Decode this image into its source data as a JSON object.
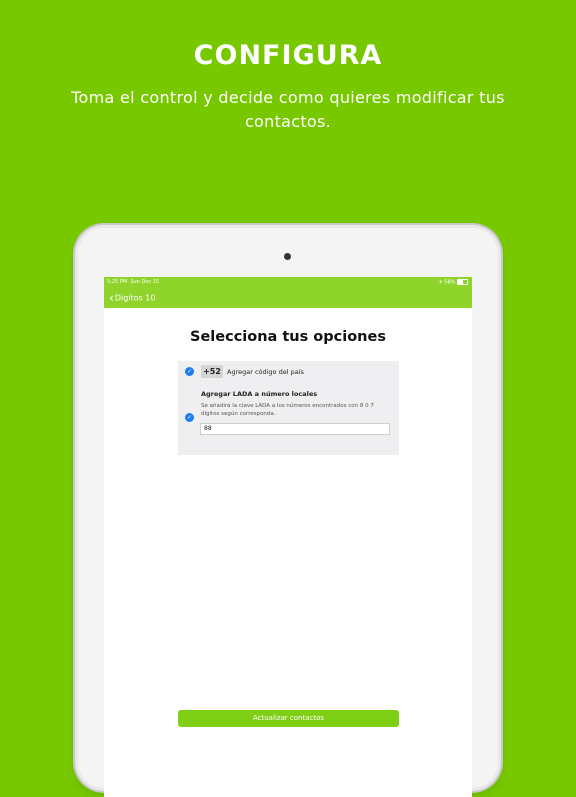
{
  "hero": {
    "title": "CONFIGURA",
    "subtitle": "Toma el control y decide como quieres modificar tus contactos."
  },
  "status_bar": {
    "time": "5:25 PM",
    "date": "Sun Dec 15",
    "battery": "58%"
  },
  "nav": {
    "back_label": "Digitos 10"
  },
  "page": {
    "title": "Selecciona tus opciones"
  },
  "options": {
    "country_code": "+52",
    "country_label": "Agregar código del país",
    "lada_title": "Agregar LADA a número locales",
    "lada_description": "Se añadirá la clave LADA a los números encontrados con 8 0 7 dígitos según corresponda.",
    "lada_value": "88"
  },
  "actions": {
    "update_label": "Actualizar contactos"
  },
  "colors": {
    "background": "#78c800",
    "navbar": "#8fd42a",
    "accent": "#1e7cf2",
    "button": "#7fcf14"
  }
}
